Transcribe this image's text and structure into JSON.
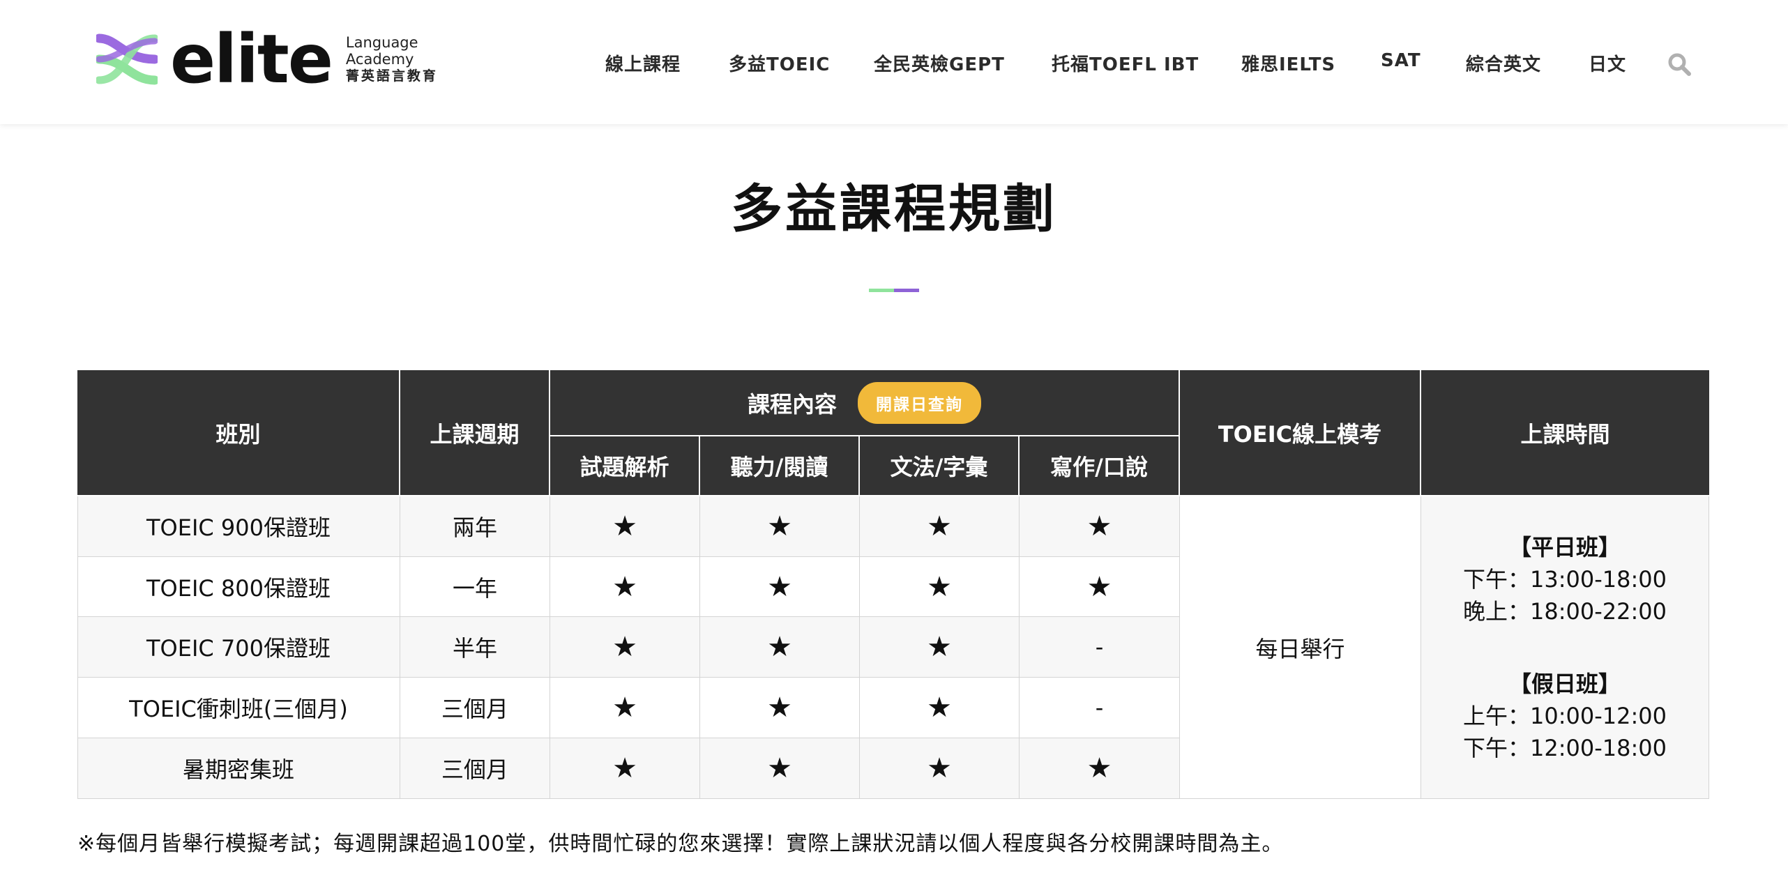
{
  "header": {
    "logo_word": "elite",
    "logo_sub_line1": "Language",
    "logo_sub_line2": "Academy",
    "logo_sub_zh": "菁英語言教育",
    "nav": [
      "線上課程",
      "多益TOEIC",
      "全民英檢GEPT",
      "托福TOEFL IBT",
      "雅思IELTS",
      "SAT",
      "綜合英文",
      "日文"
    ]
  },
  "page_title": "多益課程規劃",
  "table": {
    "headers": {
      "class": "班別",
      "period": "上課週期",
      "content": "課程內容",
      "content_badge": "開課日查詢",
      "sub": [
        "試題解析",
        "聽力/閱讀",
        "文法/字彙",
        "寫作/口說"
      ],
      "mock": "TOEIC線上模考",
      "time": "上課時間"
    },
    "rows": [
      {
        "name": "TOEIC 900保證班",
        "period": "兩年",
        "marks": [
          "★",
          "★",
          "★",
          "★"
        ]
      },
      {
        "name": "TOEIC 800保證班",
        "period": "一年",
        "marks": [
          "★",
          "★",
          "★",
          "★"
        ]
      },
      {
        "name": "TOEIC 700保證班",
        "period": "半年",
        "marks": [
          "★",
          "★",
          "★",
          "-"
        ]
      },
      {
        "name": "TOEIC衝刺班(三個月)",
        "period": "三個月",
        "marks": [
          "★",
          "★",
          "★",
          "-"
        ]
      },
      {
        "name": "暑期密集班",
        "period": "三個月",
        "marks": [
          "★",
          "★",
          "★",
          "★"
        ]
      }
    ],
    "mock_value": "每日舉行",
    "schedule": {
      "weekday_title": "【平日班】",
      "weekday_1": "下午：13:00-18:00",
      "weekday_2": "晚上：18:00-22:00",
      "weekend_title": "【假日班】",
      "weekend_1": "上午：10:00-12:00",
      "weekend_2": "下午：12:00-18:00"
    }
  },
  "note": "※每個月皆舉行模擬考試；每週開課超過100堂，供時間忙碌的您來選擇！實際上課狀況請以個人程度與各分校開課時間為主。"
}
